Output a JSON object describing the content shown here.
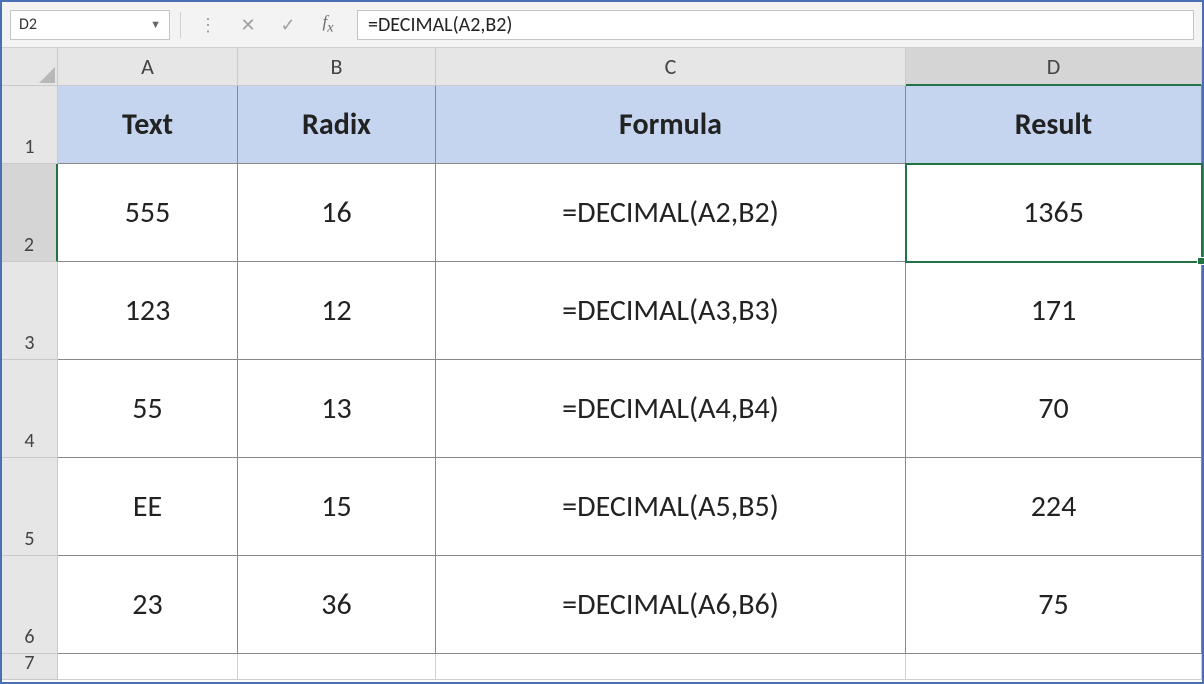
{
  "name_box": "D2",
  "formula_bar": "=DECIMAL(A2,B2)",
  "columns": [
    "A",
    "B",
    "C",
    "D"
  ],
  "row_labels": [
    "1",
    "2",
    "3",
    "4",
    "5",
    "6",
    "7"
  ],
  "active_cell": {
    "row": 2,
    "col": "D"
  },
  "headers": {
    "A": "Text",
    "B": "Radix",
    "C": "Formula",
    "D": "Result"
  },
  "rows": [
    {
      "text": "555",
      "radix": "16",
      "formula": "=DECIMAL(A2,B2)",
      "result": "1365"
    },
    {
      "text": "123",
      "radix": "12",
      "formula": "=DECIMAL(A3,B3)",
      "result": "171"
    },
    {
      "text": "55",
      "radix": "13",
      "formula": "=DECIMAL(A4,B4)",
      "result": "70"
    },
    {
      "text": "EE",
      "radix": "15",
      "formula": "=DECIMAL(A5,B5)",
      "result": "224"
    },
    {
      "text": "23",
      "radix": "36",
      "formula": "=DECIMAL(A6,B6)",
      "result": "75"
    }
  ]
}
